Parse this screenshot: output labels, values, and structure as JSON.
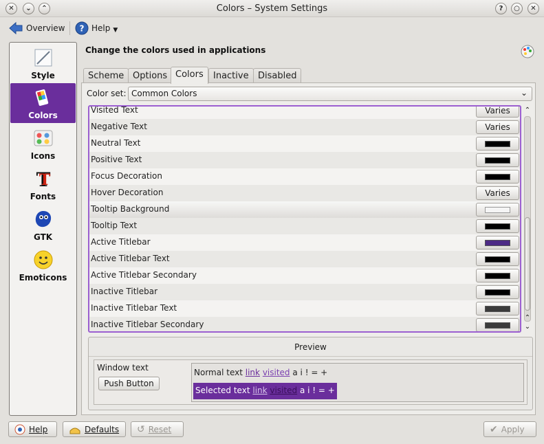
{
  "window": {
    "title": "Colors – System Settings",
    "controls": [
      "✕",
      "⌄",
      "⌃",
      "?",
      "○",
      "✕"
    ]
  },
  "toolbar": {
    "overview_label": "Overview",
    "help_label": "Help"
  },
  "sidebar": {
    "items": [
      {
        "label": "Style",
        "icon": "style-icon"
      },
      {
        "label": "Colors",
        "icon": "colors-icon",
        "selected": true
      },
      {
        "label": "Icons",
        "icon": "icons-icon"
      },
      {
        "label": "Fonts",
        "icon": "fonts-icon"
      },
      {
        "label": "GTK",
        "icon": "gtk-icon"
      },
      {
        "label": "Emoticons",
        "icon": "emoticons-icon"
      }
    ]
  },
  "header": {
    "title": "Change the colors used in applications"
  },
  "tabs": [
    {
      "label": "Scheme"
    },
    {
      "label": "Options"
    },
    {
      "label": "Colors",
      "active": true
    },
    {
      "label": "Inactive"
    },
    {
      "label": "Disabled"
    }
  ],
  "colorset": {
    "label": "Color set:",
    "value": "Common Colors"
  },
  "colors": [
    {
      "name": "Visited Text",
      "value": "Varies"
    },
    {
      "name": "Negative Text",
      "value": "Varies"
    },
    {
      "name": "Neutral Text",
      "swatch": "#000000"
    },
    {
      "name": "Positive Text",
      "swatch": "#000000"
    },
    {
      "name": "Focus Decoration",
      "swatch": "#000000"
    },
    {
      "name": "Hover Decoration",
      "value": "Varies"
    },
    {
      "name": "Tooltip Background",
      "swatch": "#f5f5f5",
      "highlighted": true
    },
    {
      "name": "Tooltip Text",
      "swatch": "#000000"
    },
    {
      "name": "Active Titlebar",
      "swatch": "#4c2a85"
    },
    {
      "name": "Active Titlebar Text",
      "swatch": "#000000"
    },
    {
      "name": "Active Titlebar Secondary",
      "swatch": "#000000"
    },
    {
      "name": "Inactive Titlebar",
      "swatch": "#000000"
    },
    {
      "name": "Inactive Titlebar Text",
      "swatch": "#3b3b3b"
    },
    {
      "name": "Inactive Titlebar Secondary",
      "swatch": "#3b3b3b"
    }
  ],
  "preview": {
    "title": "Preview",
    "window_text": "Window text",
    "push_button": "Push Button",
    "normal_text": "Normal text",
    "selected_text": "Selected text",
    "link": "link",
    "visited": "visited",
    "symbols": "a i ! = +"
  },
  "buttons": {
    "help": "Help",
    "defaults": "Defaults",
    "reset": "Reset",
    "apply": "Apply"
  },
  "accent": "#6a2e9c"
}
